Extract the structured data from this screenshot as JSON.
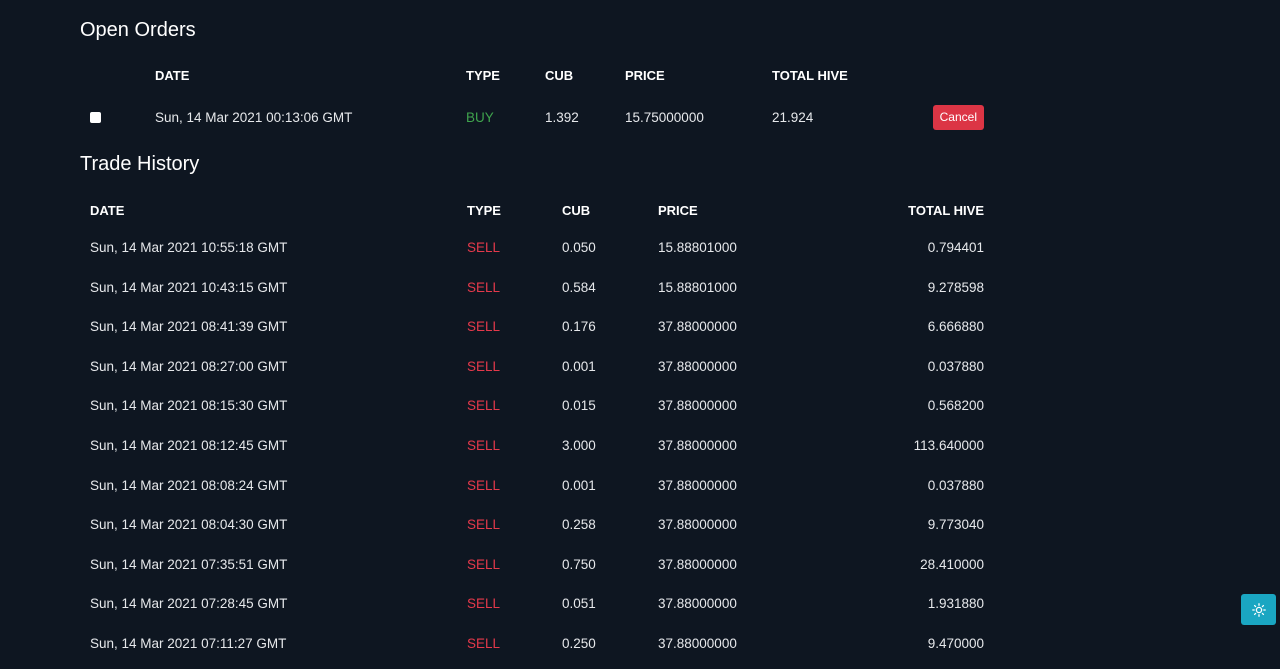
{
  "open_orders": {
    "title": "Open Orders",
    "headers": {
      "date": "DATE",
      "type": "TYPE",
      "cub": "CUB",
      "price": "PRICE",
      "total": "TOTAL HIVE"
    },
    "rows": [
      {
        "date": "Sun, 14 Mar 2021 00:13:06 GMT",
        "type": "BUY",
        "cub": "1.392",
        "price": "15.75000000",
        "total": "21.924",
        "action": "Cancel"
      }
    ]
  },
  "trade_history": {
    "title": "Trade History",
    "headers": {
      "date": "DATE",
      "type": "TYPE",
      "cub": "CUB",
      "price": "PRICE",
      "total": "TOTAL HIVE"
    },
    "rows": [
      {
        "date": "Sun, 14 Mar 2021 10:55:18 GMT",
        "type": "SELL",
        "cub": "0.050",
        "price": "15.88801000",
        "total": "0.794401"
      },
      {
        "date": "Sun, 14 Mar 2021 10:43:15 GMT",
        "type": "SELL",
        "cub": "0.584",
        "price": "15.88801000",
        "total": "9.278598"
      },
      {
        "date": "Sun, 14 Mar 2021 08:41:39 GMT",
        "type": "SELL",
        "cub": "0.176",
        "price": "37.88000000",
        "total": "6.666880"
      },
      {
        "date": "Sun, 14 Mar 2021 08:27:00 GMT",
        "type": "SELL",
        "cub": "0.001",
        "price": "37.88000000",
        "total": "0.037880"
      },
      {
        "date": "Sun, 14 Mar 2021 08:15:30 GMT",
        "type": "SELL",
        "cub": "0.015",
        "price": "37.88000000",
        "total": "0.568200"
      },
      {
        "date": "Sun, 14 Mar 2021 08:12:45 GMT",
        "type": "SELL",
        "cub": "3.000",
        "price": "37.88000000",
        "total": "113.640000"
      },
      {
        "date": "Sun, 14 Mar 2021 08:08:24 GMT",
        "type": "SELL",
        "cub": "0.001",
        "price": "37.88000000",
        "total": "0.037880"
      },
      {
        "date": "Sun, 14 Mar 2021 08:04:30 GMT",
        "type": "SELL",
        "cub": "0.258",
        "price": "37.88000000",
        "total": "9.773040"
      },
      {
        "date": "Sun, 14 Mar 2021 07:35:51 GMT",
        "type": "SELL",
        "cub": "0.750",
        "price": "37.88000000",
        "total": "28.410000"
      },
      {
        "date": "Sun, 14 Mar 2021 07:28:45 GMT",
        "type": "SELL",
        "cub": "0.051",
        "price": "37.88000000",
        "total": "1.931880"
      },
      {
        "date": "Sun, 14 Mar 2021 07:11:27 GMT",
        "type": "SELL",
        "cub": "0.250",
        "price": "37.88000000",
        "total": "9.470000"
      }
    ]
  },
  "theme_toggle": {
    "icon": "sun-icon"
  },
  "colors": {
    "background": "#0e1621",
    "buy": "#3fa34d",
    "sell": "#e5394b",
    "cancel": "#dc3545",
    "accent": "#1aa6c2"
  }
}
